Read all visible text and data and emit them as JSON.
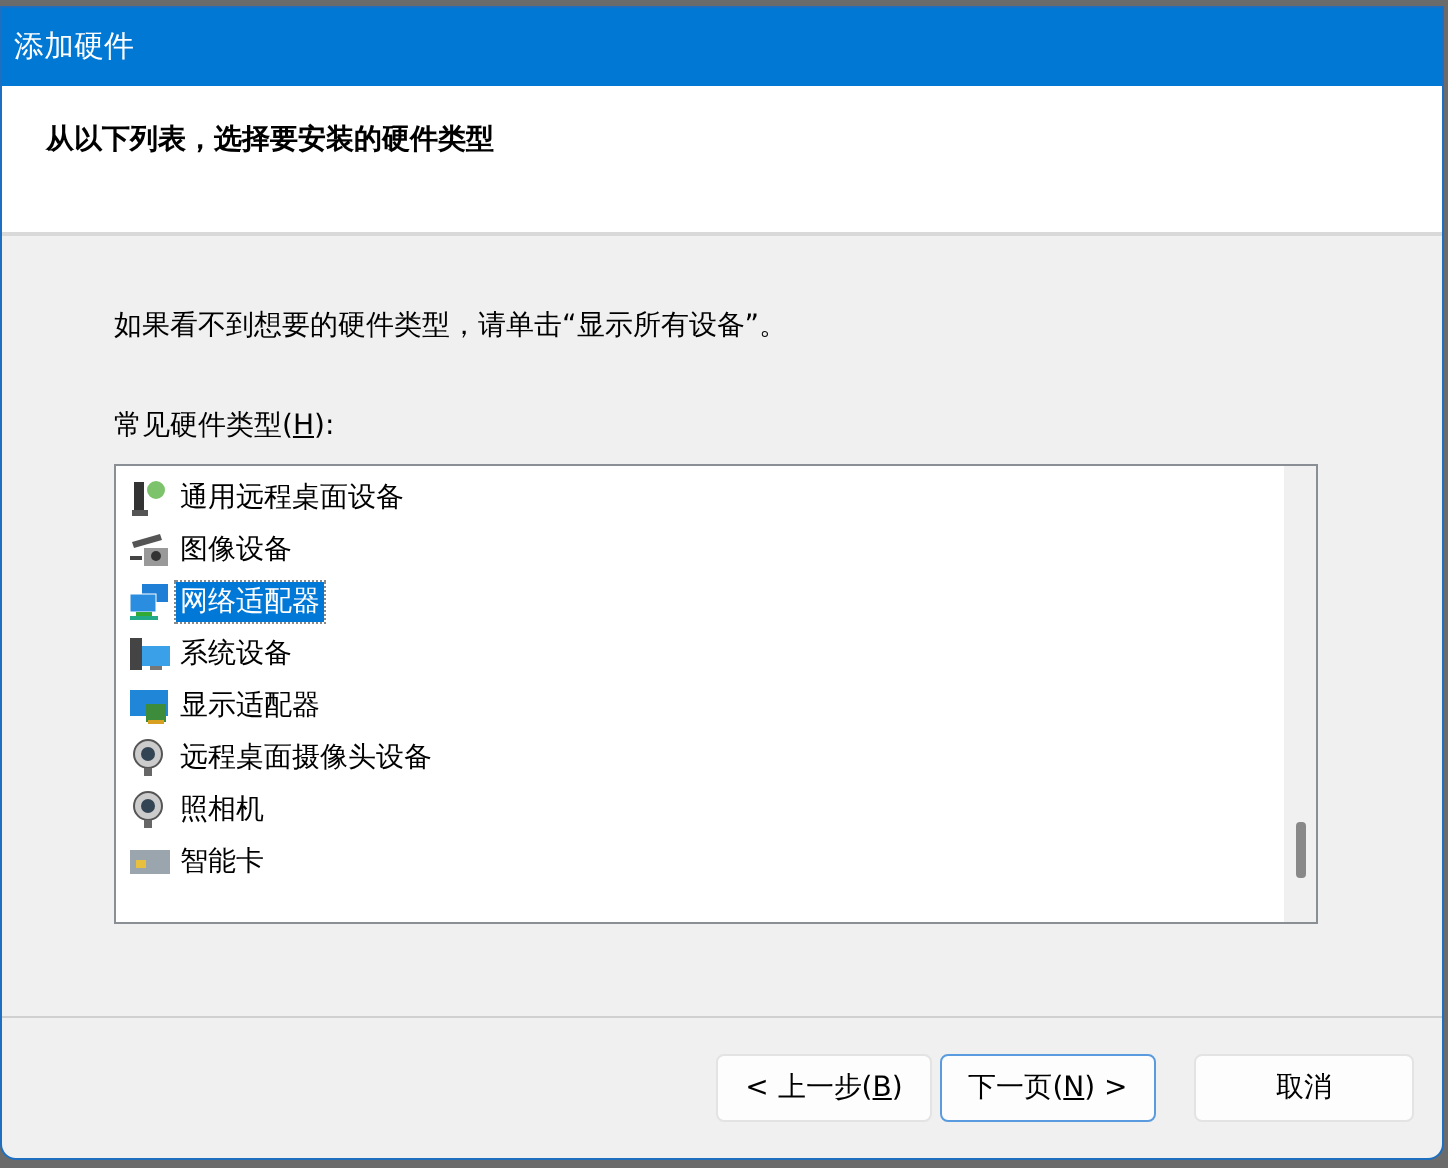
{
  "window": {
    "title": "添加硬件"
  },
  "header": {
    "heading": "从以下列表，选择要安装的硬件类型"
  },
  "hint": "如果看不到想要的硬件类型，请单击“显示所有设备”。",
  "list_label": {
    "before": "常见硬件类型(",
    "key": "H",
    "after": "):"
  },
  "items": [
    {
      "label": "通用远程桌面设备",
      "selected": false
    },
    {
      "label": "图像设备",
      "selected": false
    },
    {
      "label": "网络适配器",
      "selected": true
    },
    {
      "label": "系统设备",
      "selected": false
    },
    {
      "label": "显示适配器",
      "selected": false
    },
    {
      "label": "远程桌面摄像头设备",
      "selected": false
    },
    {
      "label": "照相机",
      "selected": false
    },
    {
      "label": "智能卡",
      "selected": false
    }
  ],
  "buttons": [
    {
      "before": "< 上一步(",
      "key": "B",
      "after": ")",
      "default": false
    },
    {
      "before": "下一页(",
      "key": "N",
      "after": ") >",
      "default": true
    },
    {
      "before": "取消",
      "default": false
    }
  ]
}
